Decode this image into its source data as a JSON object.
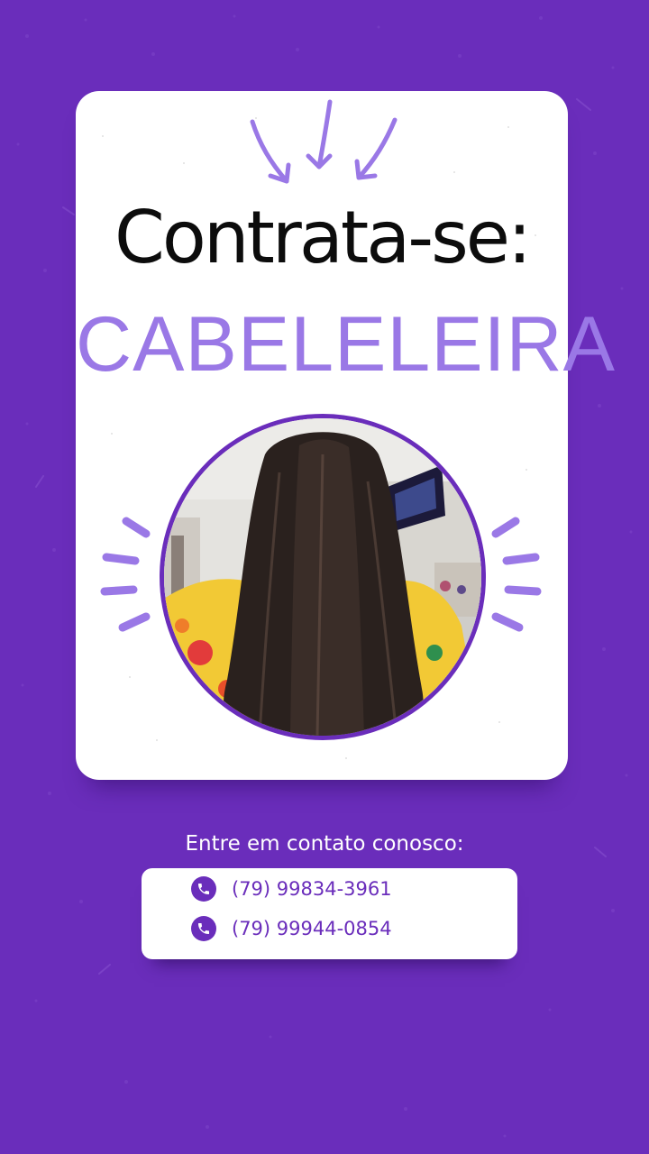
{
  "colors": {
    "background": "#6a2dbb",
    "card": "#ffffff",
    "title": "#0c0c0c",
    "accent_lavender": "#9a78e6",
    "phone_text": "#6a2dbb"
  },
  "poster": {
    "title": "Contrata-se:",
    "subtitle": "CABELELEIRA"
  },
  "contact": {
    "heading": "Entre em contato conosco:",
    "phones": [
      {
        "icon": "phone-icon",
        "number": "(79) 99834-3961"
      },
      {
        "icon": "phone-icon",
        "number": "(79) 99944-0854"
      }
    ]
  },
  "decorations": {
    "top_icon": "arrows-down-icon",
    "side_icons": "sparkle-rays-icon",
    "photo": "long-dark-hair-photo"
  }
}
